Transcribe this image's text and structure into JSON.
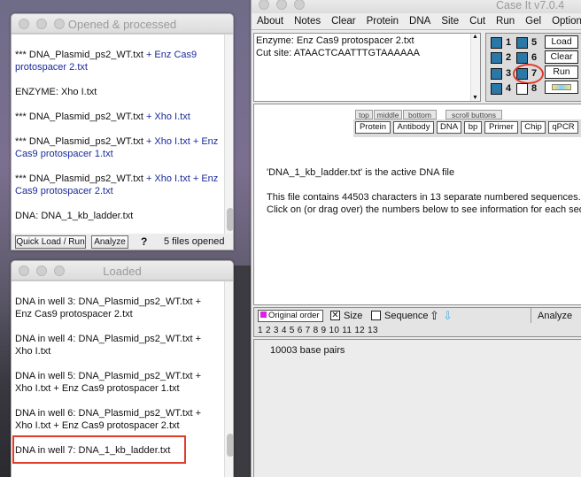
{
  "opened_window": {
    "title": "Opened & processed",
    "entries": [
      {
        "prefix": "*** DNA_Plasmid_ps2_WT.txt",
        "suffix": " + Enz Cas9 protospacer 2.txt"
      },
      {
        "prefix": "ENZYME: Xho I.txt",
        "suffix": ""
      },
      {
        "prefix": "*** DNA_Plasmid_ps2_WT.txt",
        "suffix": " + Xho I.txt"
      },
      {
        "prefix": "*** DNA_Plasmid_ps2_WT.txt",
        "suffix": " + Xho I.txt + Enz Cas9 protospacer 1.txt"
      },
      {
        "prefix": "*** DNA_Plasmid_ps2_WT.txt",
        "suffix": " + Xho I.txt + Enz Cas9 protospacer 2.txt"
      },
      {
        "prefix": "DNA: DNA_1_kb_ladder.txt",
        "suffix": ""
      }
    ],
    "quick_load_label": "Quick Load / Run",
    "analyze_label": "Analyze",
    "help_label": "?",
    "files_opened": "5  files opened"
  },
  "loaded_window": {
    "title": "Loaded",
    "entries": [
      "DNA in well 3:  DNA_Plasmid_ps2_WT.txt + Enz Cas9 protospacer 2.txt",
      "DNA in well 4:  DNA_Plasmid_ps2_WT.txt + Xho I.txt",
      "DNA in well 5:  DNA_Plasmid_ps2_WT.txt + Xho I.txt + Enz Cas9 protospacer 1.txt",
      "DNA in well 6:  DNA_Plasmid_ps2_WT.txt + Xho I.txt + Enz Cas9 protospacer 2.txt",
      "DNA in well 7:  DNA_1_kb_ladder.txt"
    ]
  },
  "main_window": {
    "title": "Case It v7.0.4",
    "menu": [
      "About",
      "Notes",
      "Clear",
      "Protein",
      "DNA",
      "Site",
      "Cut",
      "Run",
      "Gel",
      "Option"
    ],
    "enzyme_line": "Enzyme: Enz Cas9 protospacer 2.txt",
    "cut_site_line": "Cut site: ATAACTCAATTTGTAAAAAA",
    "wells": [
      {
        "num": "1",
        "on": true
      },
      {
        "num": "5",
        "on": true
      },
      {
        "num": "2",
        "on": true
      },
      {
        "num": "6",
        "on": true
      },
      {
        "num": "3",
        "on": true
      },
      {
        "num": "7",
        "on": true
      },
      {
        "num": "4",
        "on": true
      },
      {
        "num": "8",
        "on": false
      }
    ],
    "side_buttons": [
      "Load",
      "Clear",
      "Run"
    ],
    "nav_tabs": [
      "top",
      "middle",
      "bottom"
    ],
    "scroll_buttons_label": "scroll buttons",
    "tool_buttons": [
      "Protein",
      "Antibody",
      "DNA",
      "bp",
      "Primer",
      "Chip",
      "qPCR"
    ],
    "active_file": "'DNA_1_kb_ladder.txt' is the active DNA file",
    "file_info": "This file contains 44503 characters in 13 separate numbered sequences.",
    "click_info": "Click on (or drag over) the numbers below to see information for each seque",
    "original_order_label": "Original order",
    "size_label": "Size",
    "sequence_label": "Sequence",
    "analyze_label": "Analyze",
    "sequence_numbers": "1 2 3 4 5 6 7 8 9 10 11 12 13",
    "base_pairs": "10003 base pairs"
  },
  "colors": {
    "highlight": "#e03c2a",
    "well_on": "#2a78a8",
    "accent_blue": "#1a2a9a"
  }
}
